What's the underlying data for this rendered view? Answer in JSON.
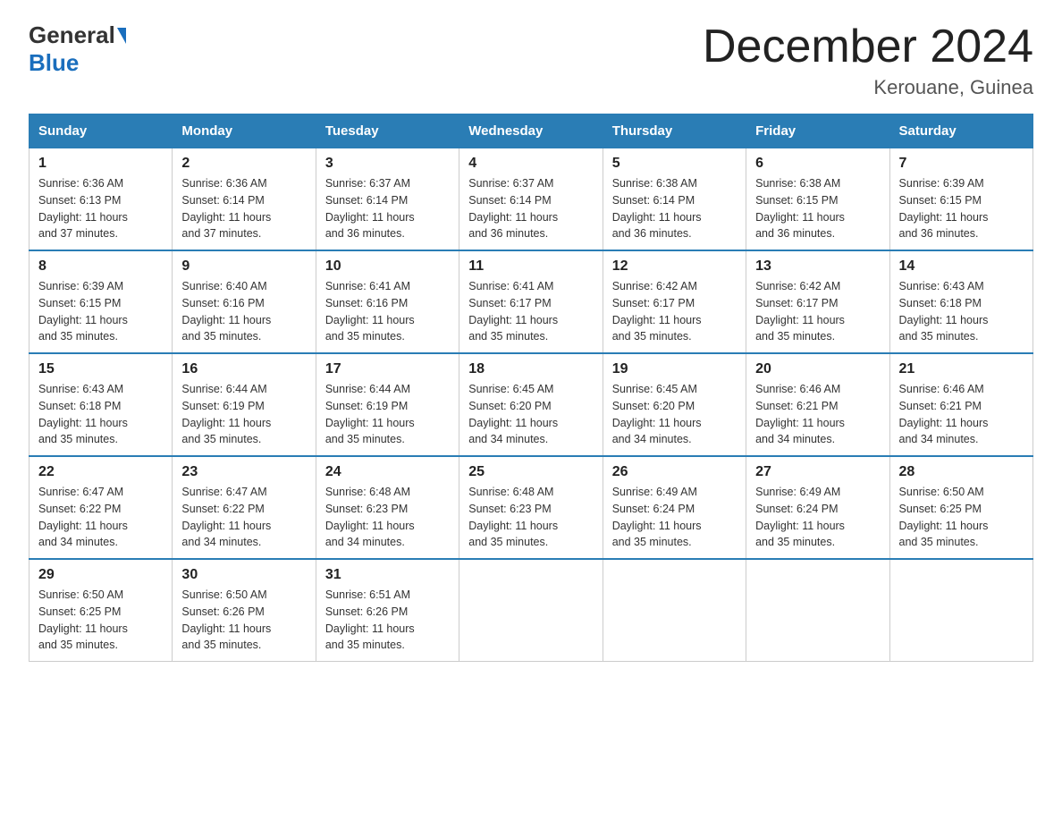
{
  "logo": {
    "general": "General",
    "blue": "Blue"
  },
  "title": "December 2024",
  "location": "Kerouane, Guinea",
  "days_of_week": [
    "Sunday",
    "Monday",
    "Tuesday",
    "Wednesday",
    "Thursday",
    "Friday",
    "Saturday"
  ],
  "weeks": [
    [
      {
        "day": "1",
        "sunrise": "6:36 AM",
        "sunset": "6:13 PM",
        "daylight": "11 hours and 37 minutes."
      },
      {
        "day": "2",
        "sunrise": "6:36 AM",
        "sunset": "6:14 PM",
        "daylight": "11 hours and 37 minutes."
      },
      {
        "day": "3",
        "sunrise": "6:37 AM",
        "sunset": "6:14 PM",
        "daylight": "11 hours and 36 minutes."
      },
      {
        "day": "4",
        "sunrise": "6:37 AM",
        "sunset": "6:14 PM",
        "daylight": "11 hours and 36 minutes."
      },
      {
        "day": "5",
        "sunrise": "6:38 AM",
        "sunset": "6:14 PM",
        "daylight": "11 hours and 36 minutes."
      },
      {
        "day": "6",
        "sunrise": "6:38 AM",
        "sunset": "6:15 PM",
        "daylight": "11 hours and 36 minutes."
      },
      {
        "day": "7",
        "sunrise": "6:39 AM",
        "sunset": "6:15 PM",
        "daylight": "11 hours and 36 minutes."
      }
    ],
    [
      {
        "day": "8",
        "sunrise": "6:39 AM",
        "sunset": "6:15 PM",
        "daylight": "11 hours and 35 minutes."
      },
      {
        "day": "9",
        "sunrise": "6:40 AM",
        "sunset": "6:16 PM",
        "daylight": "11 hours and 35 minutes."
      },
      {
        "day": "10",
        "sunrise": "6:41 AM",
        "sunset": "6:16 PM",
        "daylight": "11 hours and 35 minutes."
      },
      {
        "day": "11",
        "sunrise": "6:41 AM",
        "sunset": "6:17 PM",
        "daylight": "11 hours and 35 minutes."
      },
      {
        "day": "12",
        "sunrise": "6:42 AM",
        "sunset": "6:17 PM",
        "daylight": "11 hours and 35 minutes."
      },
      {
        "day": "13",
        "sunrise": "6:42 AM",
        "sunset": "6:17 PM",
        "daylight": "11 hours and 35 minutes."
      },
      {
        "day": "14",
        "sunrise": "6:43 AM",
        "sunset": "6:18 PM",
        "daylight": "11 hours and 35 minutes."
      }
    ],
    [
      {
        "day": "15",
        "sunrise": "6:43 AM",
        "sunset": "6:18 PM",
        "daylight": "11 hours and 35 minutes."
      },
      {
        "day": "16",
        "sunrise": "6:44 AM",
        "sunset": "6:19 PM",
        "daylight": "11 hours and 35 minutes."
      },
      {
        "day": "17",
        "sunrise": "6:44 AM",
        "sunset": "6:19 PM",
        "daylight": "11 hours and 35 minutes."
      },
      {
        "day": "18",
        "sunrise": "6:45 AM",
        "sunset": "6:20 PM",
        "daylight": "11 hours and 34 minutes."
      },
      {
        "day": "19",
        "sunrise": "6:45 AM",
        "sunset": "6:20 PM",
        "daylight": "11 hours and 34 minutes."
      },
      {
        "day": "20",
        "sunrise": "6:46 AM",
        "sunset": "6:21 PM",
        "daylight": "11 hours and 34 minutes."
      },
      {
        "day": "21",
        "sunrise": "6:46 AM",
        "sunset": "6:21 PM",
        "daylight": "11 hours and 34 minutes."
      }
    ],
    [
      {
        "day": "22",
        "sunrise": "6:47 AM",
        "sunset": "6:22 PM",
        "daylight": "11 hours and 34 minutes."
      },
      {
        "day": "23",
        "sunrise": "6:47 AM",
        "sunset": "6:22 PM",
        "daylight": "11 hours and 34 minutes."
      },
      {
        "day": "24",
        "sunrise": "6:48 AM",
        "sunset": "6:23 PM",
        "daylight": "11 hours and 34 minutes."
      },
      {
        "day": "25",
        "sunrise": "6:48 AM",
        "sunset": "6:23 PM",
        "daylight": "11 hours and 35 minutes."
      },
      {
        "day": "26",
        "sunrise": "6:49 AM",
        "sunset": "6:24 PM",
        "daylight": "11 hours and 35 minutes."
      },
      {
        "day": "27",
        "sunrise": "6:49 AM",
        "sunset": "6:24 PM",
        "daylight": "11 hours and 35 minutes."
      },
      {
        "day": "28",
        "sunrise": "6:50 AM",
        "sunset": "6:25 PM",
        "daylight": "11 hours and 35 minutes."
      }
    ],
    [
      {
        "day": "29",
        "sunrise": "6:50 AM",
        "sunset": "6:25 PM",
        "daylight": "11 hours and 35 minutes."
      },
      {
        "day": "30",
        "sunrise": "6:50 AM",
        "sunset": "6:26 PM",
        "daylight": "11 hours and 35 minutes."
      },
      {
        "day": "31",
        "sunrise": "6:51 AM",
        "sunset": "6:26 PM",
        "daylight": "11 hours and 35 minutes."
      },
      null,
      null,
      null,
      null
    ]
  ],
  "labels": {
    "sunrise": "Sunrise:",
    "sunset": "Sunset:",
    "daylight": "Daylight:"
  }
}
